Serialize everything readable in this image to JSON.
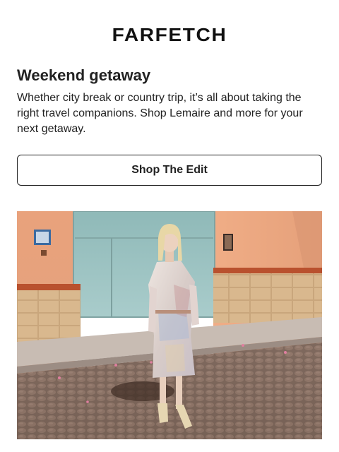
{
  "brand": {
    "logo_text": "FARFETCH"
  },
  "content": {
    "headline": "Weekend getaway",
    "body": "Whether city break or country trip, it’s all about taking the right travel companions. Shop Lemaire and more for your next getaway.",
    "cta_label": "Shop The Edit"
  },
  "colors": {
    "text": "#222222",
    "background": "#ffffff",
    "button_border": "#222222"
  },
  "hero_image": {
    "icon": "photo-model-street"
  }
}
